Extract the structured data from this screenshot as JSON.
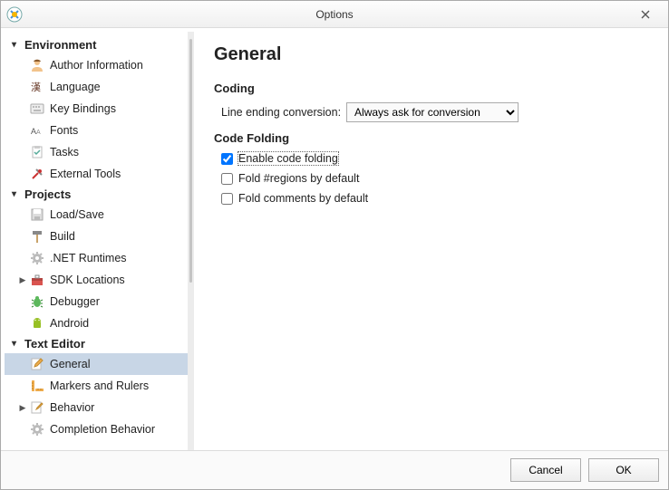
{
  "window": {
    "title": "Options"
  },
  "sidebar": {
    "categories": [
      {
        "label": "Environment",
        "expanded": true,
        "items": [
          {
            "label": "Author Information",
            "icon": "author-icon"
          },
          {
            "label": "Language",
            "icon": "language-icon"
          },
          {
            "label": "Key Bindings",
            "icon": "keybindings-icon"
          },
          {
            "label": "Fonts",
            "icon": "fonts-icon"
          },
          {
            "label": "Tasks",
            "icon": "tasks-icon"
          },
          {
            "label": "External Tools",
            "icon": "tools-icon"
          }
        ]
      },
      {
        "label": "Projects",
        "expanded": true,
        "items": [
          {
            "label": "Load/Save",
            "icon": "disk-icon"
          },
          {
            "label": "Build",
            "icon": "hammer-icon"
          },
          {
            "label": ".NET Runtimes",
            "icon": "gear-icon"
          },
          {
            "label": "SDK Locations",
            "icon": "toolbox-icon",
            "expandable": true
          },
          {
            "label": "Debugger",
            "icon": "bug-icon"
          },
          {
            "label": "Android",
            "icon": "android-icon"
          }
        ]
      },
      {
        "label": "Text Editor",
        "expanded": true,
        "items": [
          {
            "label": "General",
            "icon": "edit-icon",
            "selected": true
          },
          {
            "label": "Markers and Rulers",
            "icon": "rulers-icon"
          },
          {
            "label": "Behavior",
            "icon": "behavior-icon",
            "expandable": true
          },
          {
            "label": "Completion Behavior",
            "icon": "gear-icon"
          }
        ]
      }
    ]
  },
  "content": {
    "heading": "General",
    "coding": {
      "section": "Coding",
      "line_ending_label": "Line ending conversion:",
      "line_ending_value": "Always ask for conversion"
    },
    "folding": {
      "section": "Code Folding",
      "enable": {
        "label": "Enable code folding",
        "checked": true
      },
      "regions": {
        "label": "Fold #regions by default",
        "checked": false
      },
      "comments": {
        "label": "Fold comments by default",
        "checked": false
      }
    }
  },
  "footer": {
    "cancel": "Cancel",
    "ok": "OK"
  }
}
